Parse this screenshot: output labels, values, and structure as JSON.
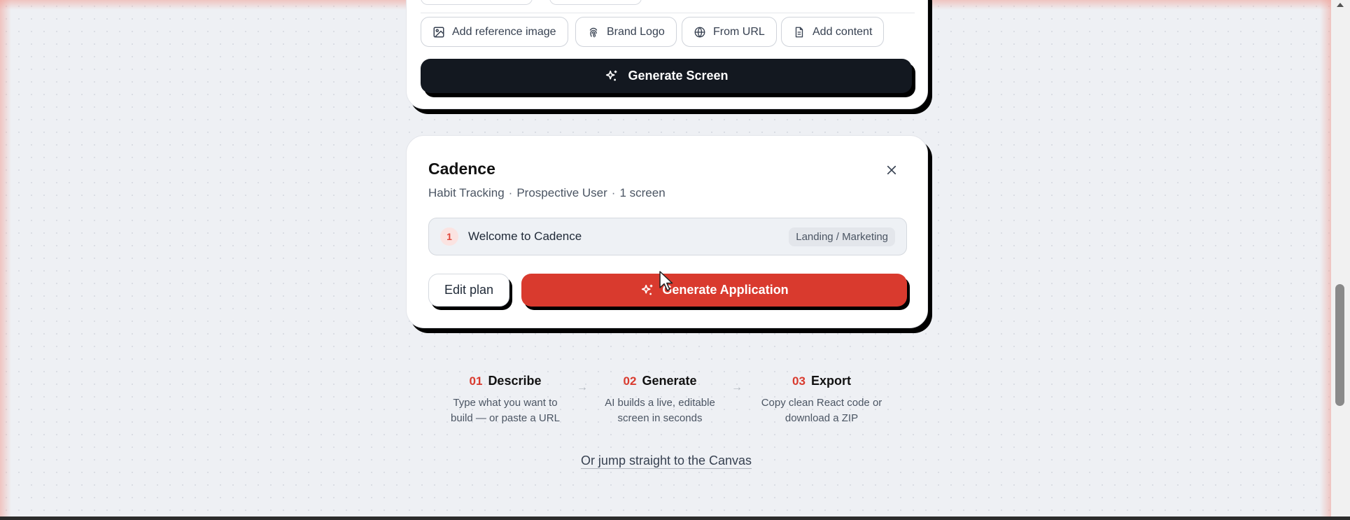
{
  "composer": {
    "chips": [
      {
        "label": "Add reference image",
        "icon": "image-icon"
      },
      {
        "label": "Brand Logo",
        "icon": "fingerprint-icon"
      },
      {
        "label": "From URL",
        "icon": "globe-icon"
      },
      {
        "label": "Add content",
        "icon": "document-icon"
      }
    ],
    "generate_label": "Generate Screen"
  },
  "plan": {
    "title": "Cadence",
    "meta": [
      "Habit Tracking",
      "Prospective User",
      "1 screen"
    ],
    "meta_separator": "·",
    "screens": [
      {
        "number": "1",
        "name": "Welcome to Cadence",
        "tag": "Landing / Marketing"
      }
    ],
    "edit_label": "Edit plan",
    "generate_label": "Generate Application"
  },
  "steps": [
    {
      "number": "01",
      "title": "Describe",
      "desc_line1": "Type what you want to",
      "desc_line2": "build — or paste a URL"
    },
    {
      "number": "02",
      "title": "Generate",
      "desc_line1": "AI builds a live, editable",
      "desc_line2": "screen in seconds"
    },
    {
      "number": "03",
      "title": "Export",
      "desc_line1": "Copy clean React code or",
      "desc_line2": "download a ZIP"
    }
  ],
  "arrow_glyph": "→",
  "canvas_link": "Or jump straight to the Canvas",
  "colors": {
    "accent": "#d93a2e",
    "dark_button": "#131820",
    "background": "#eef0f4"
  }
}
